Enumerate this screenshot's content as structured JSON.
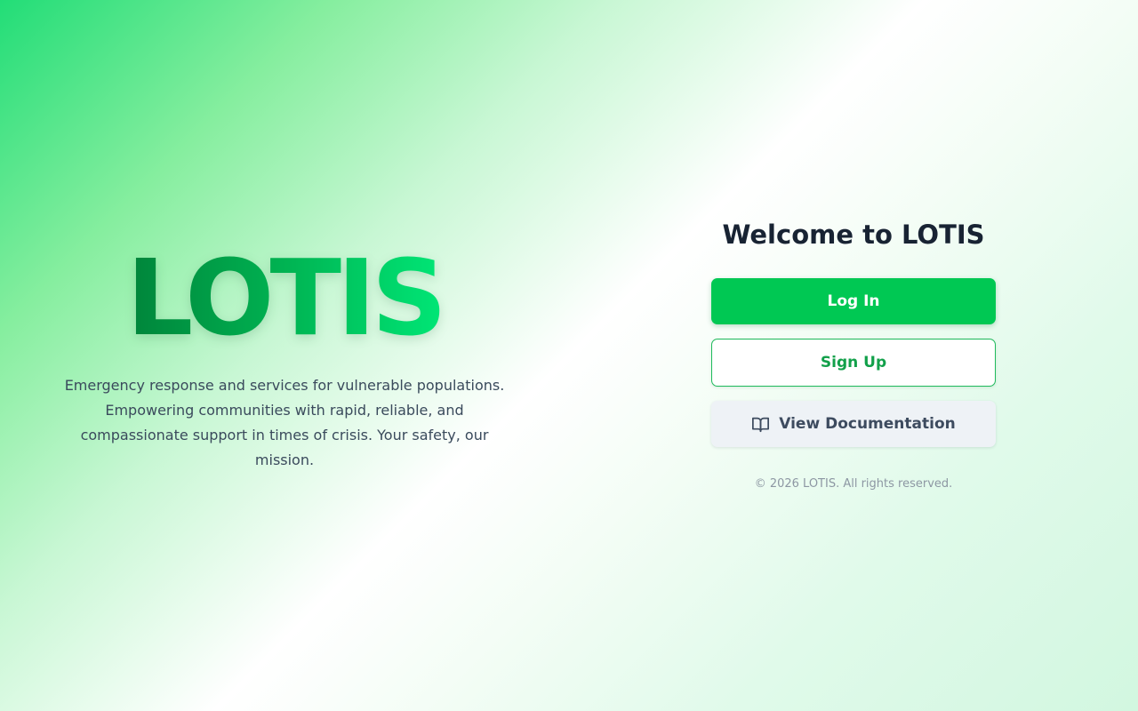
{
  "hero": {
    "logo_text": "LOTIS",
    "tagline": "Emergency response and services for vulnerable populations. Empowering communities with rapid, reliable, and compassionate support in times of crisis. Your safety, our mission."
  },
  "auth_panel": {
    "title": "Welcome to LOTIS",
    "login_label": "Log In",
    "signup_label": "Sign Up",
    "docs_label": "View Documentation",
    "docs_icon": "book-icon",
    "copyright": "© 2026 LOTIS. All rights reserved."
  },
  "colors": {
    "primary": "#00c853",
    "primary_dark": "#00843a",
    "accent_bright": "#00e676",
    "text_dark": "#182333",
    "muted": "#8d97a3"
  }
}
